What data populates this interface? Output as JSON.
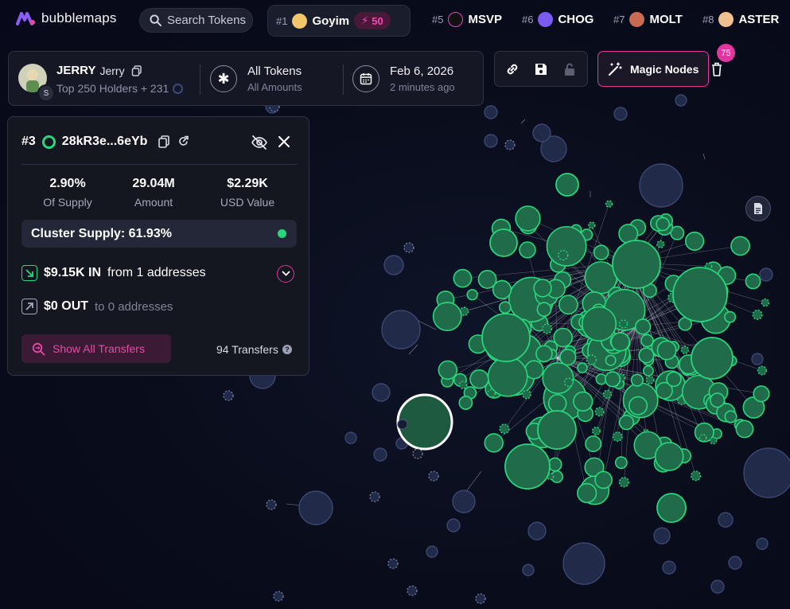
{
  "app": {
    "logo_text": "bubblemaps"
  },
  "search": {
    "label": "Search Tokens"
  },
  "tickers": [
    {
      "rank": "#1",
      "name": "Goyim",
      "boost": "50",
      "avatar_color": "#f3c66a"
    },
    {
      "rank": "#5",
      "name": "MSVP",
      "avatar_color": "#111111"
    },
    {
      "rank": "#6",
      "name": "CHOG",
      "avatar_color": "#7b5cf0"
    },
    {
      "rank": "#7",
      "name": "MOLT",
      "avatar_color": "#c96a52"
    },
    {
      "rank": "#8",
      "name": "ASTER",
      "avatar_color": "#f0c090"
    }
  ],
  "token": {
    "symbol": "JERRY",
    "name": "Jerry",
    "holders_text": "Top 250 Holders + 231",
    "chain_badge": "S"
  },
  "filter": {
    "title": "All Tokens",
    "subtitle": "All Amounts"
  },
  "date": {
    "title": "Feb 6, 2026",
    "subtitle": "2 minutes ago"
  },
  "magic": {
    "label": "Magic Nodes",
    "badge": "75"
  },
  "node_panel": {
    "rank": "#3",
    "address": "28kR3e...6eYb",
    "stats": [
      {
        "value": "2.90%",
        "label": "Of Supply"
      },
      {
        "value": "29.04M",
        "label": "Amount"
      },
      {
        "value": "$2.29K",
        "label": "USD Value"
      }
    ],
    "cluster_supply": "Cluster Supply: 61.93%",
    "in_amount": "$9.15K IN",
    "in_from": "from 1 addresses",
    "out_amount": "$0 OUT",
    "out_to": "to 0 addresses",
    "show_all": "Show All Transfers",
    "transfers": "94 Transfers"
  },
  "colors": {
    "accent_pink": "#e1359f",
    "green": "#29d67c",
    "node_green": "#1f6b4a",
    "node_blue": "#222a4a"
  },
  "icons": [
    "search-icon",
    "copy-icon",
    "asterisk-icon",
    "calendar-icon",
    "link-icon",
    "save-icon",
    "lock-icon",
    "magic-wand-icon",
    "trash-icon",
    "eye-off-icon",
    "close-icon",
    "refresh-icon",
    "arrow-in-icon",
    "arrow-out-icon",
    "chevron-down-icon",
    "search-transfers-icon",
    "help-icon",
    "document-icon"
  ]
}
